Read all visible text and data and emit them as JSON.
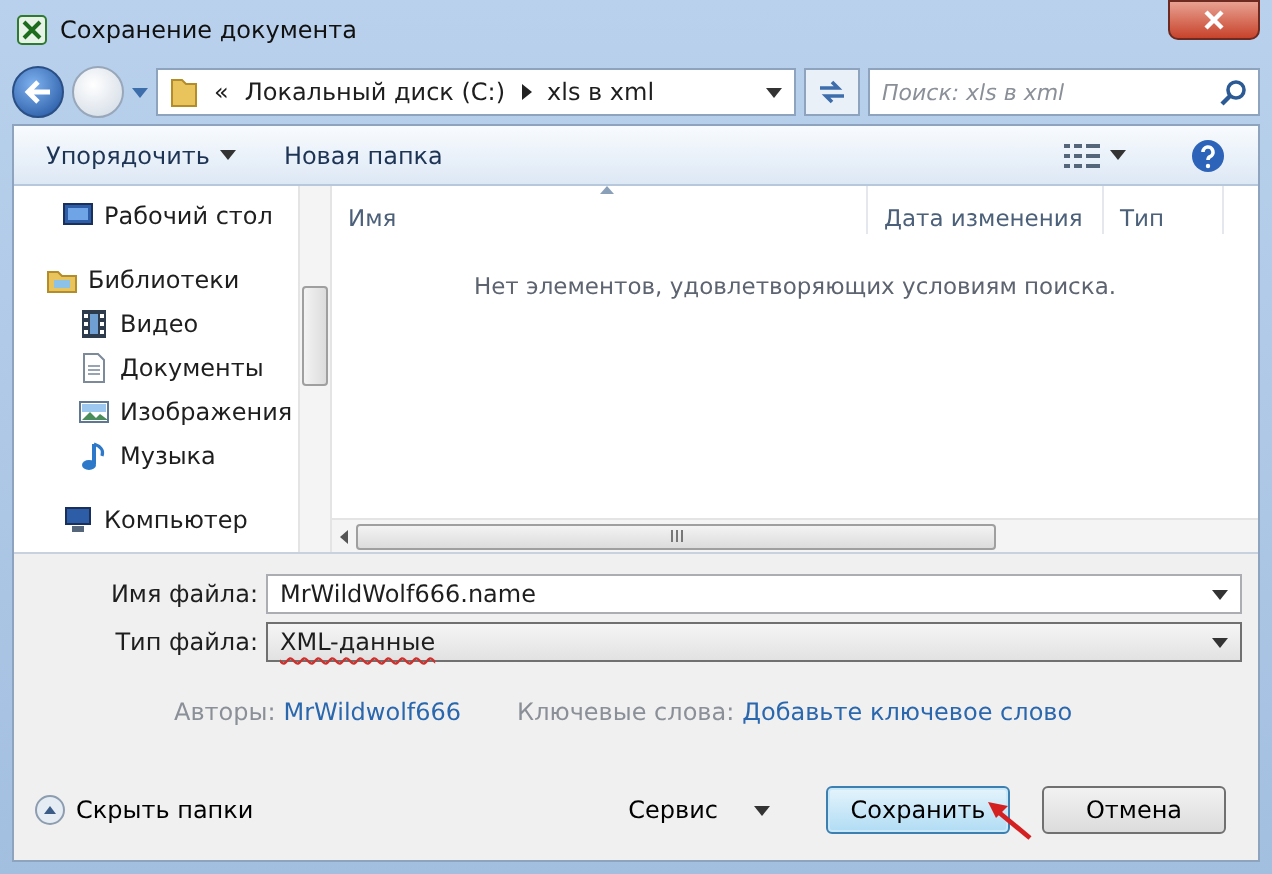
{
  "window": {
    "title": "Сохранение документа"
  },
  "address_bar": {
    "overflow": "«",
    "path": [
      "Локальный диск (C:)",
      "xls в xml"
    ]
  },
  "search": {
    "placeholder": "Поиск: xls в xml"
  },
  "toolbar": {
    "organize": "Упорядочить",
    "new_folder": "Новая папка"
  },
  "sidebar": {
    "items": [
      {
        "label": "Рабочий стол",
        "kind": "desktop"
      },
      {
        "label": "Библиотеки",
        "kind": "library",
        "children": [
          {
            "label": "Видео",
            "kind": "video"
          },
          {
            "label": "Документы",
            "kind": "documents"
          },
          {
            "label": "Изображения",
            "kind": "pictures"
          },
          {
            "label": "Музыка",
            "kind": "music"
          }
        ]
      },
      {
        "label": "Компьютер",
        "kind": "computer"
      }
    ]
  },
  "file_list": {
    "columns": [
      {
        "label": "Имя",
        "sorted": true
      },
      {
        "label": "Дата изменения",
        "sorted": false
      },
      {
        "label": "Тип",
        "sorted": false
      }
    ],
    "empty_message": "Нет элементов, удовлетворяющих условиям поиска."
  },
  "form": {
    "file_name": {
      "label": "Имя файла:",
      "value": "MrWildWolf666.name"
    },
    "file_type": {
      "label": "Тип файла:",
      "value": "XML-данные"
    }
  },
  "metadata": [
    {
      "label": "Авторы:",
      "value": "MrWildwolf666"
    },
    {
      "label": "Ключевые слова:",
      "value": "Добавьте ключевое слово"
    }
  ],
  "footer": {
    "hide_folders": "Скрыть папки",
    "tools": "Сервис",
    "buttons": [
      {
        "label": "Сохранить",
        "kind": "primary"
      },
      {
        "label": "Отмена",
        "kind": "secondary"
      }
    ]
  }
}
